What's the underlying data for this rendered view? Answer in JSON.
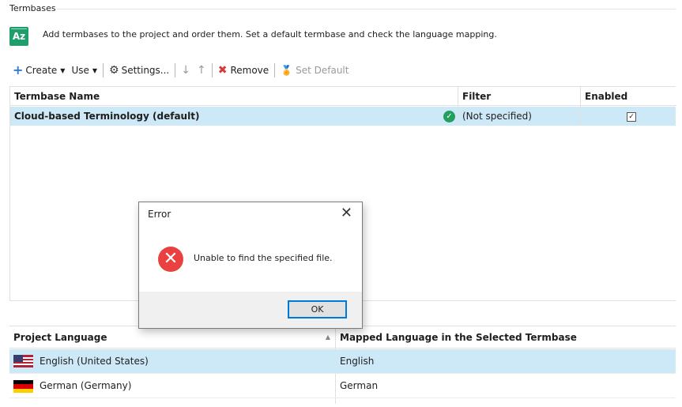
{
  "group": {
    "title": "Termbases"
  },
  "header": {
    "icon": "termbase-az-icon",
    "icon_text": "Az",
    "description": "Add termbases to the project and order them. Set a default termbase and check the language mapping."
  },
  "toolbar": {
    "create": "Create",
    "use": "Use",
    "settings": "Settings...",
    "remove": "Remove",
    "set_default": "Set Default"
  },
  "termbases": {
    "columns": [
      "Termbase Name",
      "Filter",
      "Enabled"
    ],
    "rows": [
      {
        "name": "Cloud-based Terminology (default)",
        "filter": "(Not specified)",
        "enabled": true,
        "status_icon": "check-circle-icon"
      }
    ]
  },
  "languages": {
    "columns": [
      "Project Language",
      "Mapped Language in the Selected Termbase"
    ],
    "rows": [
      {
        "project": "English (United States)",
        "mapped": "English",
        "flag": "us-flag-icon"
      },
      {
        "project": "German (Germany)",
        "mapped": "German",
        "flag": "de-flag-icon"
      }
    ]
  },
  "dialog": {
    "title": "Error",
    "message": "Unable to find the specified file.",
    "ok": "OK"
  },
  "colors": {
    "selection": "#cde8f7",
    "accent": "#0078d7",
    "error": "#e9413f",
    "success": "#23a05d"
  }
}
